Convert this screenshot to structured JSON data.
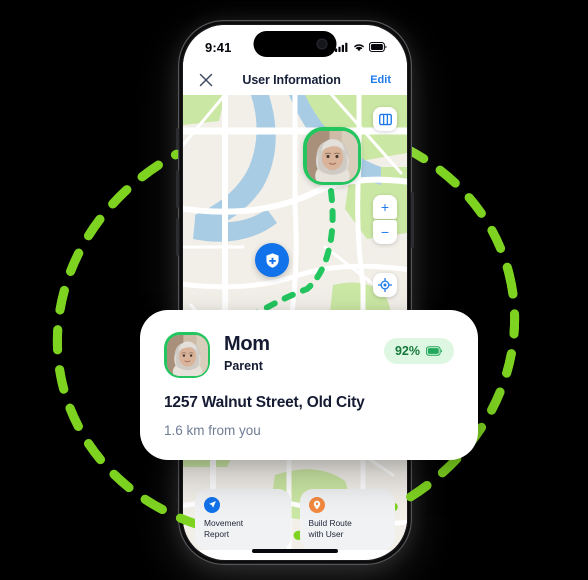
{
  "status_bar": {
    "time": "9:41",
    "icons": [
      "cellular-signal-icon",
      "wifi-icon",
      "battery-icon"
    ]
  },
  "header": {
    "close_icon": "close-icon",
    "title": "User Information",
    "edit_label": "Edit"
  },
  "map": {
    "controls": [
      {
        "name": "map-layers-button",
        "icon": "map-layers-icon"
      },
      {
        "name": "zoom-in-button",
        "icon": "plus-icon",
        "label": "+"
      },
      {
        "name": "zoom-out-button",
        "icon": "minus-icon",
        "label": "−"
      },
      {
        "name": "locate-me-button",
        "icon": "crosshair-icon"
      }
    ],
    "user_marker": {
      "name": "user-avatar-marker",
      "person": "Mom"
    },
    "place_marker": {
      "name": "safe-place-marker",
      "icon": "shield-plus-icon"
    },
    "route": {
      "name": "route-path",
      "style": "dashed",
      "color": "#22c55e"
    },
    "colors": {
      "land": "#f2efe9",
      "water": "#a8cce4",
      "park": "#cbe7a4",
      "road": "#ffffff"
    }
  },
  "info_card": {
    "name": "Mom",
    "role": "Parent",
    "battery_percent": "92%",
    "battery_icon": "battery-icon",
    "address": "1257 Walnut Street, Old City",
    "distance": "1.6 km from you"
  },
  "actions": [
    {
      "name": "movement-report-button",
      "icon": "navigation-arrow-icon",
      "icon_color": "#1272ea",
      "line1": "Movement",
      "line2": "Report"
    },
    {
      "name": "build-route-button",
      "icon": "map-pin-icon",
      "icon_color": "#f2893f",
      "line1": "Build Route",
      "line2": "with User"
    }
  ],
  "decoration": {
    "orbit_color": "#7ed321",
    "background": "#000000"
  }
}
